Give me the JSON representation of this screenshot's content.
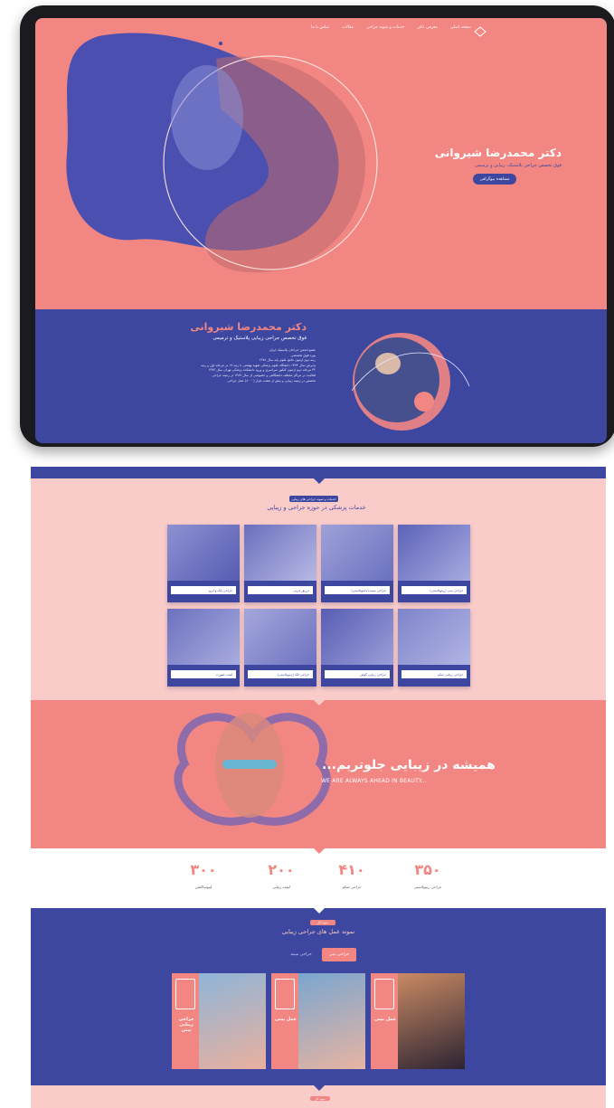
{
  "hero": {
    "nav": [
      "صفحه اصلی",
      "معرفی دکتر",
      "خدمات و نمونه جراحی",
      "مقالات",
      "تماس با ما"
    ],
    "title": "دکتر محمدرضا شیروانی",
    "subtitle": "فوق تخصص جراحی پلاستیک، زیبایی و ترمیمی",
    "button": "مشاهده بیوگرافی"
  },
  "about": {
    "title": "دکتر محمدرضا شیروانی",
    "subtitle": "فوق تخصص جراحی زیبایی پلاستیک و ترمیمی",
    "bullets": [
      "عضو انجمن جراحان پلاستیک ایران",
      "بورد فوق تخصصی",
      "رتبه دوم آزمون جامع علوم پایه سال ۱۳۷۸",
      "پذیرش سال ۱۳۷۴ دانشگاه علوم پزشکی شهید بهشتی با رتبه ۱۷ در مرحله اول و رتبه",
      "۳۴ مرحله دوم آزمون کنکور سراسری و ورود دانشکده پزشکی تهران سال ۱۳۷۴",
      "فعالیت در مراکز مختلف دانشگاهی و خصوصی از سال ۱۳۸۷ در زمینه جراحی",
      "تخصص در زمینه زیبایی و بیش از هشت هزار (۸۰۰۰) عمل جراحی"
    ]
  },
  "services": {
    "badge": "خدمات و نمونه جراحی های زیبایی",
    "title": "خدمات پزشکی در حوزه جراحی و زیبایی",
    "cards": [
      {
        "label": "جراحی بینی (رینوپلاستی)"
      },
      {
        "label": "جراحی سینه (ماموپلاستی)"
      },
      {
        "label": "تزریق چربی"
      },
      {
        "label": "جراحی پلک و ابرو"
      },
      {
        "label": "جراحی زیبایی شکم"
      },
      {
        "label": "جراحی زیبایی گوش"
      },
      {
        "label": "جراحی فک (ژنیوپلاستی)"
      },
      {
        "label": "لیفت صورت"
      }
    ]
  },
  "banner": {
    "title": "همیشه در زیبایی جلوتریم...",
    "subtitle": "WE ARE ALWAYS AHEAD IN BEAUTY..."
  },
  "stats": [
    {
      "number": "۳۵۰",
      "label": "جراحی رینوپلاستی"
    },
    {
      "number": "۴۱۰",
      "label": "جراحی شکم"
    },
    {
      "number": "۲۰۰",
      "label": "لیفت زیبایی"
    },
    {
      "number": "۳۰۰",
      "label": "لیپوساکشن"
    }
  ],
  "gallery": {
    "badge": "نمونه کار",
    "title": "نمونه عمل های جراحی زیبایی",
    "tabs": [
      "جراحی بینی",
      "جراحی سینه"
    ],
    "cards": [
      {
        "name": "عمل بینی"
      },
      {
        "name": "عمل بینی"
      },
      {
        "name": "جراحی زیبایی بینی"
      }
    ]
  },
  "bottom": {
    "badge": "نمونه کار"
  },
  "colors": {
    "coral": "#f28683",
    "indigo": "#3e47a0",
    "pink": "#f9cbc9"
  }
}
